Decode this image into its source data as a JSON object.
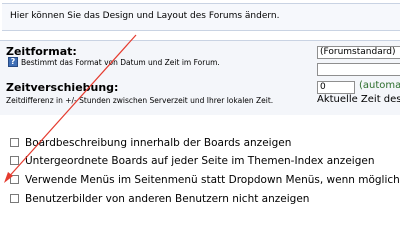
{
  "intro": {
    "text": "Hier können Sie das Design und Layout des Forums ändern."
  },
  "time_format": {
    "title": "Zeitformat:",
    "description": "Bestimmt das Format von Datum und Zeit im Forum.",
    "select_value": "(Forumstandard)",
    "custom_value": "",
    "help_icon": "help-icon"
  },
  "time_offset": {
    "title": "Zeitverschiebung:",
    "description": "Zeitdifferenz in +/- Stunden zwischen Serverzeit und Ihrer lokalen Zeit.",
    "value": "0",
    "auto_label": "(automat",
    "current_time_label": "Aktuelle Zeit des"
  },
  "options": [
    {
      "label": "Boardbeschreibung innerhalb der Boards anzeigen",
      "checked": false
    },
    {
      "label": "Untergeordnete Boards auf jeder Seite im Themen-Index anzeigen",
      "checked": false
    },
    {
      "label": "Verwende Menüs im Seitenmenü statt Dropdown Menüs, wenn möglich.",
      "checked": false
    },
    {
      "label": "Benutzerbilder von anderen Benutzern nicht anzeigen",
      "checked": false
    }
  ],
  "annotation": {
    "color": "#e53b2f"
  }
}
